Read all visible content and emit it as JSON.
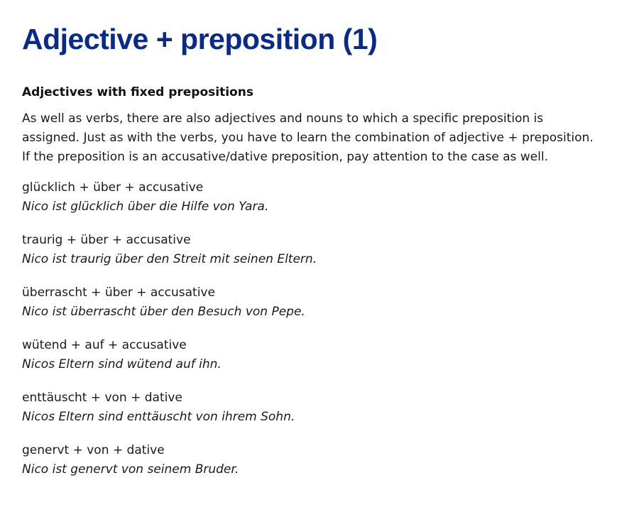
{
  "page": {
    "title": "Adjective + preposition (1)",
    "subtitle": "Adjectives with fixed prepositions",
    "intro": "As well as verbs, there are also adjectives and nouns to which a specific preposition is assigned. Just as with the verbs, you have to learn the combination of adjective + preposition. If the preposition is an accusative/dative preposition, pay attention to the case as well.",
    "examples": [
      {
        "formula": "glücklich + über + accusative",
        "sentence": "Nico ist glücklich über die Hilfe von Yara."
      },
      {
        "formula": "traurig + über + accusative",
        "sentence": "Nico ist traurig über den Streit mit seinen Eltern."
      },
      {
        "formula": "überrascht + über + accusative",
        "sentence": "Nico ist überrascht über den Besuch von Pepe."
      },
      {
        "formula": "wütend + auf + accusative",
        "sentence": "Nicos Eltern sind wütend auf ihn."
      },
      {
        "formula": "enttäuscht + von + dative",
        "sentence": "Nicos Eltern sind enttäuscht von ihrem Sohn."
      },
      {
        "formula": "genervt + von + dative",
        "sentence": "Nico ist genervt von seinem Bruder."
      }
    ]
  },
  "colors": {
    "title": "#0a2a8a",
    "text": "#1a1a1a",
    "background": "#ffffff"
  }
}
